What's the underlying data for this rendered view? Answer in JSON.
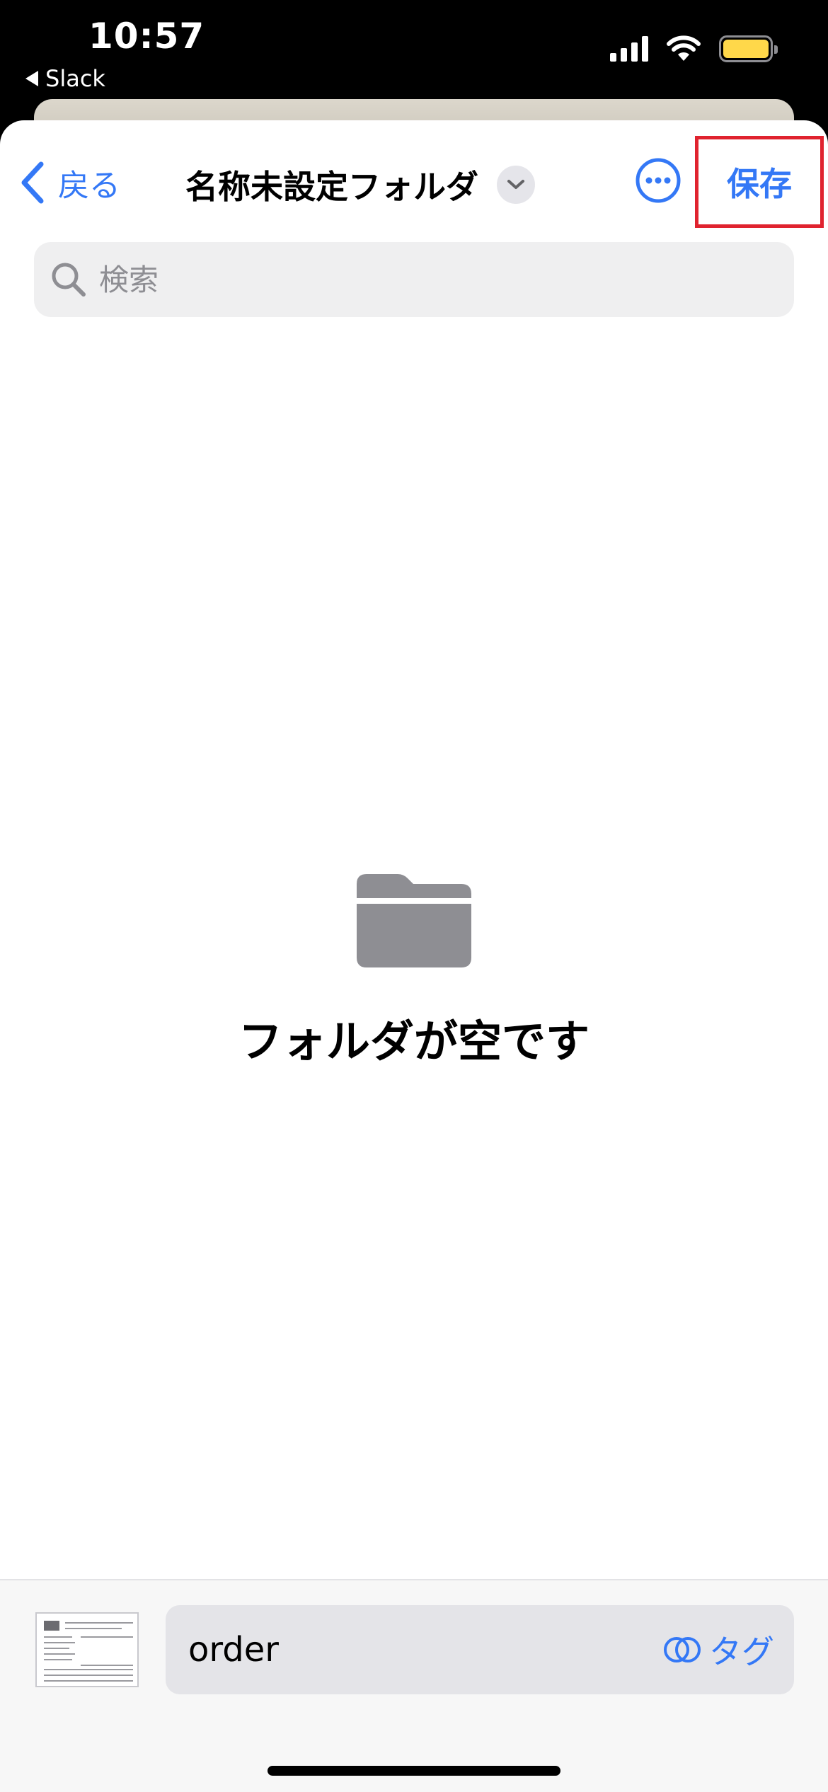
{
  "status_bar": {
    "time": "10:57",
    "back_app": "Slack",
    "battery_color": "#ffd84a"
  },
  "nav": {
    "back_label": "戻る",
    "title": "名称未設定フォルダ",
    "save_label": "保存"
  },
  "search": {
    "placeholder": "検索"
  },
  "empty_state": {
    "icon": "folder-icon",
    "message": "フォルダが空です"
  },
  "bottom_bar": {
    "filename_value": "order",
    "tag_label": "タグ"
  },
  "colors": {
    "accent": "#3478f6",
    "highlight_border": "#e0232f"
  }
}
